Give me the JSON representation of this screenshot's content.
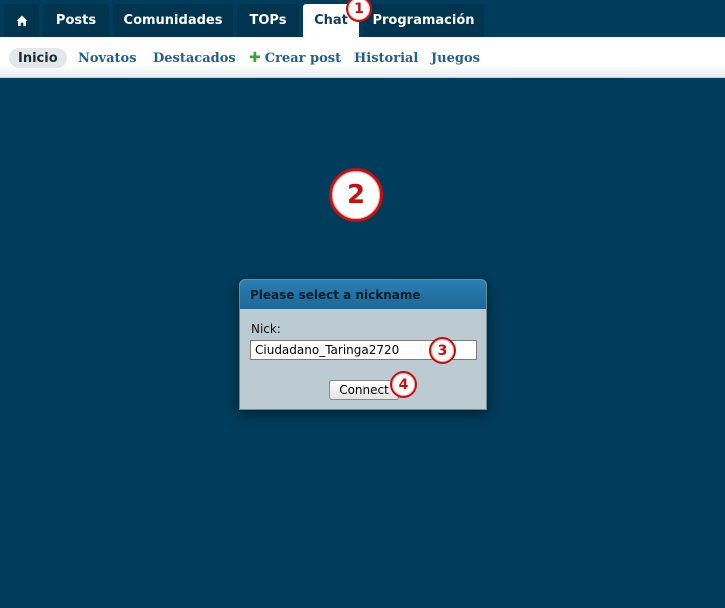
{
  "top_nav": {
    "home_icon": "home-icon",
    "tabs": [
      {
        "label": "Posts"
      },
      {
        "label": "Comunidades"
      },
      {
        "label": "TOPs"
      },
      {
        "label": "Chat",
        "active": true
      },
      {
        "label": "Programación"
      }
    ]
  },
  "sub_nav": {
    "items": [
      {
        "label": "Inicio",
        "active": true
      },
      {
        "label": "Novatos"
      },
      {
        "label": "Destacados"
      },
      {
        "label": "Crear post",
        "icon": "plus-icon"
      },
      {
        "label": "Historial"
      },
      {
        "label": "Juegos"
      }
    ]
  },
  "markers": [
    "1",
    "2",
    "3",
    "4"
  ],
  "dialog": {
    "title": "Please select a nickname",
    "nick_label": "Nick:",
    "nick_value": "Ciudadano_Taringa2720",
    "connect_label": "Connect"
  },
  "colors": {
    "background": "#003d5c",
    "tab_bg": "#00344f",
    "marker_red": "#c41010",
    "link_blue": "#205f8e"
  }
}
